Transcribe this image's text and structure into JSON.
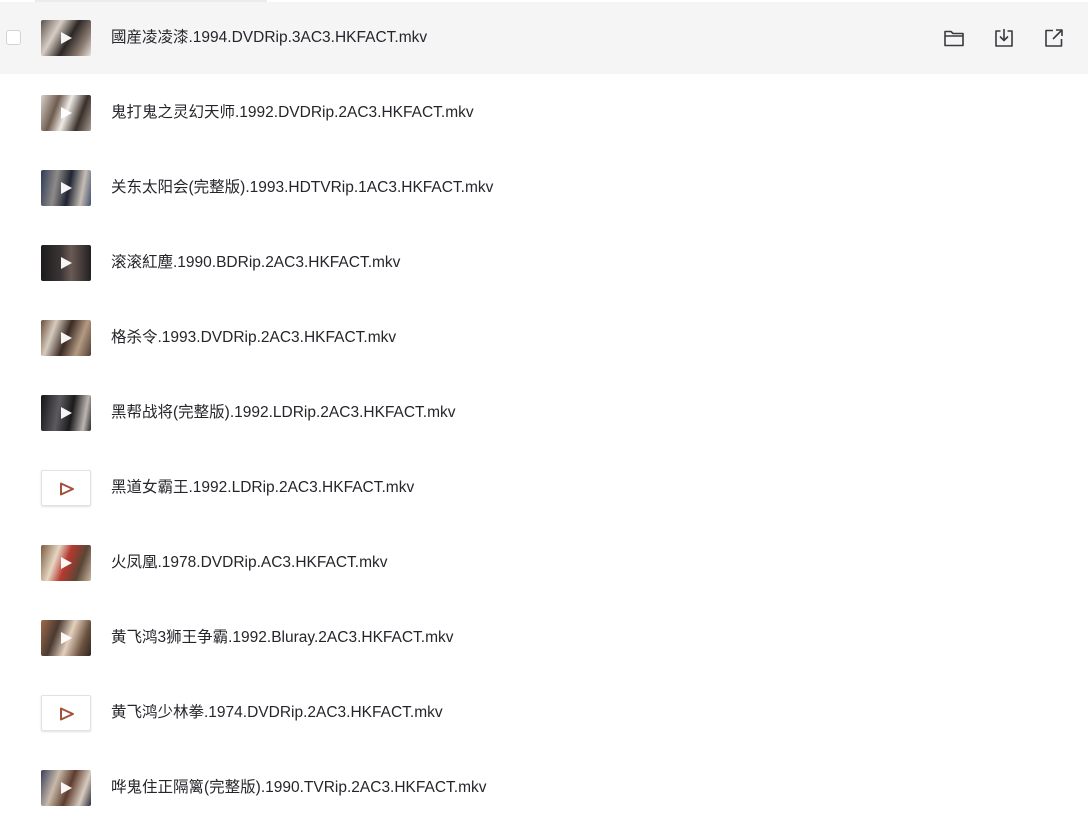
{
  "files": [
    {
      "name": "國産凌凌漆.1994.DVDRip.3AC3.HKFACT.mkv",
      "thumbnail": "video-thumbnail",
      "hovered": true
    },
    {
      "name": "鬼打鬼之灵幻天师.1992.DVDRip.2AC3.HKFACT.mkv",
      "thumbnail": "video-thumbnail"
    },
    {
      "name": "关东太阳会(完整版).1993.HDTVRip.1AC3.HKFACT.mkv",
      "thumbnail": "video-thumbnail"
    },
    {
      "name": "滚滚紅塵.1990.BDRip.2AC3.HKFACT.mkv",
      "thumbnail": "video-thumbnail"
    },
    {
      "name": "格杀令.1993.DVDRip.2AC3.HKFACT.mkv",
      "thumbnail": "video-thumbnail"
    },
    {
      "name": "黑帮战将(完整版).1992.LDRip.2AC3.HKFACT.mkv",
      "thumbnail": "video-thumbnail"
    },
    {
      "name": "黑道女霸王.1992.LDRip.2AC3.HKFACT.mkv",
      "thumbnail": "generic-video-icon"
    },
    {
      "name": "火凤凰.1978.DVDRip.AC3.HKFACT.mkv",
      "thumbnail": "video-thumbnail"
    },
    {
      "name": "黄飞鸿3狮王争霸.1992.Bluray.2AC3.HKFACT.mkv",
      "thumbnail": "video-thumbnail"
    },
    {
      "name": "黄飞鸿少林拳.1974.DVDRip.2AC3.HKFACT.mkv",
      "thumbnail": "generic-video-icon"
    },
    {
      "name": "哗鬼住正隔篱(完整版).1990.TVRip.2AC3.HKFACT.mkv",
      "thumbnail": "video-thumbnail"
    }
  ],
  "row_actions": [
    "folder-icon",
    "download-icon",
    "share-icon"
  ],
  "colors": {
    "hover_background": "#f5f5f6",
    "text": "#25262b",
    "icon": "#3a3b40",
    "play_accent": "#a2513a"
  }
}
